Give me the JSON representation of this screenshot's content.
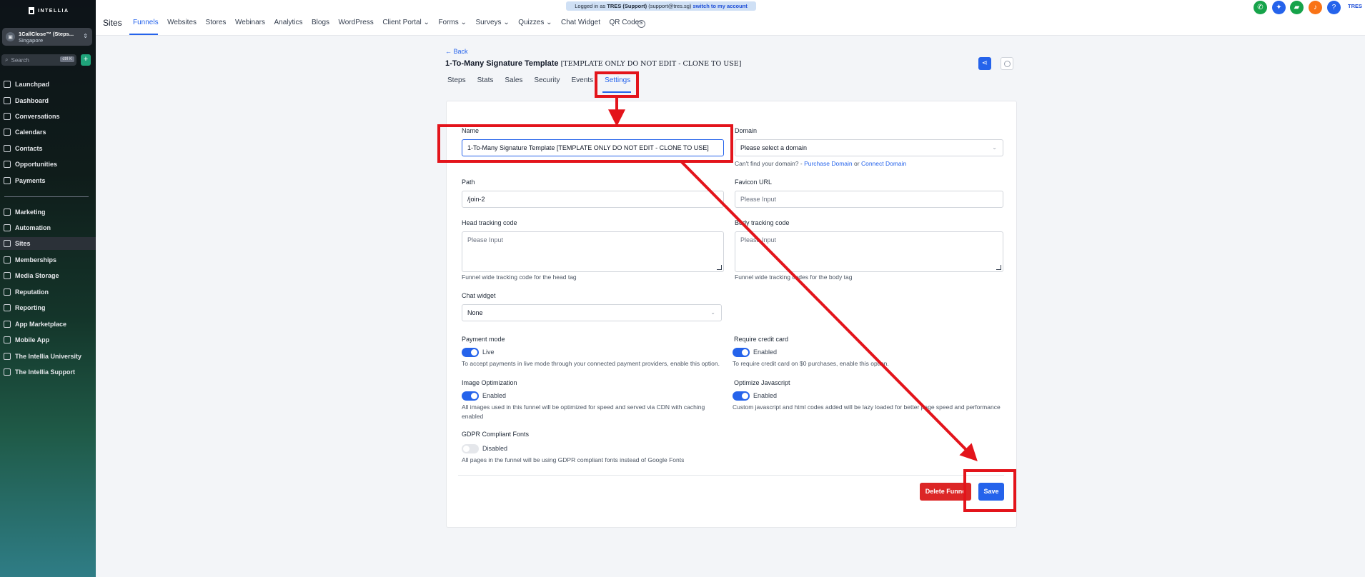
{
  "sidebar": {
    "logo": "INTELLIA",
    "account": {
      "name": "1CallClose™ (Steps...",
      "location": "Singapore"
    },
    "search": {
      "placeholder": "Search",
      "shortcut": "ctrl K"
    },
    "items": [
      {
        "label": "Launchpad",
        "icon": "rocket-icon"
      },
      {
        "label": "Dashboard",
        "icon": "grid-icon"
      },
      {
        "label": "Conversations",
        "icon": "chat-icon"
      },
      {
        "label": "Calendars",
        "icon": "calendar-icon"
      },
      {
        "label": "Contacts",
        "icon": "contacts-icon"
      },
      {
        "label": "Opportunities",
        "icon": "funnel-icon"
      },
      {
        "label": "Payments",
        "icon": "payments-icon"
      },
      {
        "label": "Marketing",
        "icon": "send-icon"
      },
      {
        "label": "Automation",
        "icon": "automation-icon"
      },
      {
        "label": "Sites",
        "icon": "sites-icon"
      },
      {
        "label": "Memberships",
        "icon": "badge-icon"
      },
      {
        "label": "Media Storage",
        "icon": "image-icon"
      },
      {
        "label": "Reputation",
        "icon": "star-icon"
      },
      {
        "label": "Reporting",
        "icon": "chart-icon"
      },
      {
        "label": "App Marketplace",
        "icon": "apps-icon"
      },
      {
        "label": "Mobile App",
        "icon": "phone-icon"
      },
      {
        "label": "The Intellia University",
        "icon": "graduation-icon"
      },
      {
        "label": "The Intellia Support",
        "icon": "headset-icon"
      }
    ]
  },
  "banner": {
    "prefix": "Logged in as",
    "user": "TRES (Support)",
    "email": "(support@tres.sg)",
    "switch": "switch to my account"
  },
  "header": {
    "section": "Sites",
    "nav": [
      "Funnels",
      "Websites",
      "Stores",
      "Webinars",
      "Analytics",
      "Blogs",
      "WordPress",
      "Client Portal ⌄",
      "Forms ⌄",
      "Surveys ⌄",
      "Quizzes ⌄",
      "Chat Widget",
      "QR Codes"
    ],
    "user": "TRES"
  },
  "page": {
    "back": "← Back",
    "title": "1-To-Many Signature Template",
    "title_tag": "[TEMPLATE ONLY DO NOT EDIT - CLONE TO USE]",
    "tabs": [
      "Steps",
      "Stats",
      "Sales",
      "Security",
      "Events",
      "Settings"
    ],
    "active_tab": "Settings"
  },
  "form": {
    "name": {
      "label": "Name",
      "value": "1-To-Many Signature Template [TEMPLATE ONLY DO NOT EDIT - CLONE TO USE]"
    },
    "domain": {
      "label": "Domain",
      "placeholder": "Please select a domain",
      "help": "Can't find your domain? -",
      "purchase": "Purchase Domain",
      "or": "or",
      "connect": "Connect Domain"
    },
    "path": {
      "label": "Path",
      "value": "/join-2"
    },
    "favicon": {
      "label": "Favicon URL",
      "placeholder": "Please Input"
    },
    "head_code": {
      "label": "Head tracking code",
      "placeholder": "Please Input",
      "help": "Funnel wide tracking code for the head tag"
    },
    "body_code": {
      "label": "Body tracking code",
      "placeholder": "Please Input",
      "help": "Funnel wide tracking codes for the body tag"
    },
    "chat": {
      "label": "Chat widget",
      "value": "None"
    },
    "payment": {
      "label": "Payment mode",
      "state": "Live",
      "help": "To accept payments in live mode through your connected payment providers, enable this option."
    },
    "credit": {
      "label": "Require credit card",
      "state": "Enabled",
      "help": "To require credit card on $0 purchases, enable this option."
    },
    "image_opt": {
      "label": "Image Optimization",
      "state": "Enabled",
      "help": "All images used in this funnel will be optimized for speed and served via CDN with caching enabled"
    },
    "js_opt": {
      "label": "Optimize Javascript",
      "state": "Enabled",
      "help": "Custom javascript and html codes added will be lazy loaded for better page speed and performance"
    },
    "gdpr": {
      "label": "GDPR Compliant Fonts",
      "state": "Disabled",
      "help": "All pages in the funnel will be using GDPR compliant fonts instead of Google Fonts"
    },
    "delete_label": "Delete Funne",
    "save_label": "Save"
  },
  "colors": {
    "accent": "#2563eb",
    "danger": "#dc2626",
    "annotation": "#e3141b"
  }
}
